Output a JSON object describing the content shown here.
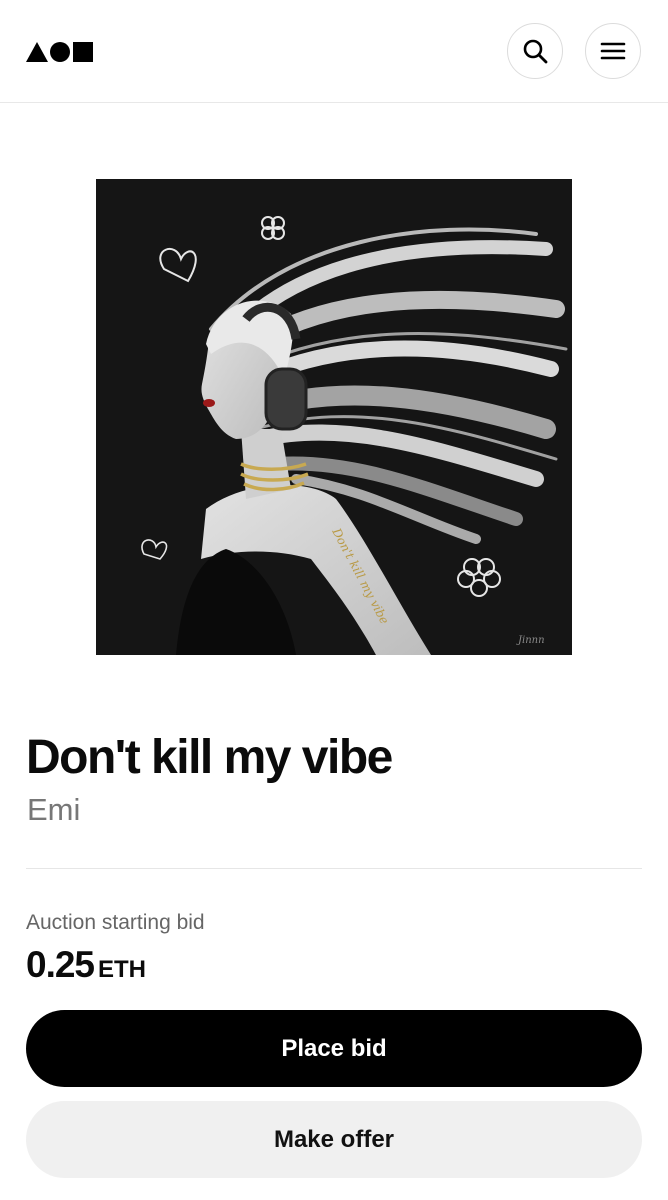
{
  "header": {
    "logo_icon": "shapes-logo-icon",
    "search_icon": "search-icon",
    "menu_icon": "hamburger-menu-icon"
  },
  "artwork": {
    "tattoo_text": "Don't kill my vibe",
    "signature": "Jinnn"
  },
  "item": {
    "title": "Don't kill my vibe",
    "artist": "Emi"
  },
  "auction": {
    "label": "Auction starting bid",
    "amount": "0.25",
    "currency": "ETH"
  },
  "actions": {
    "place_bid": "Place bid",
    "make_offer": "Make offer"
  },
  "colors": {
    "primary_button": "#000000",
    "secondary_button": "#f0f0f0",
    "artwork_background": "#151515"
  }
}
